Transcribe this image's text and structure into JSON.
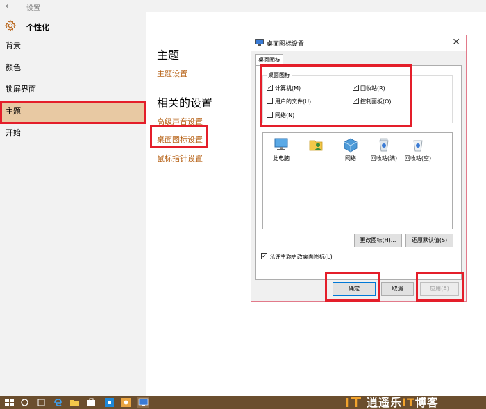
{
  "settings": {
    "title": "设置",
    "header": "个性化",
    "nav": [
      "背景",
      "颜色",
      "锁屏界面",
      "主题",
      "开始"
    ],
    "selected_index": 3
  },
  "content": {
    "theme_heading": "主题",
    "theme_settings_link": "主题设置",
    "related_heading": "相关的设置",
    "links": [
      "高级声音设置",
      "桌面图标设置",
      "鼠标指针设置"
    ]
  },
  "dialog": {
    "title": "桌面图标设置",
    "tab": "桌面图标",
    "group_label": "桌面图标",
    "checkboxes": [
      {
        "label": "计算机(M)",
        "checked": true
      },
      {
        "label": "回收站(R)",
        "checked": true
      },
      {
        "label": "用户的文件(U)",
        "checked": false
      },
      {
        "label": "控制面板(O)",
        "checked": true
      },
      {
        "label": "网络(N)",
        "checked": false
      }
    ],
    "icons": [
      {
        "label": "此电脑",
        "icon": "this-pc-icon"
      },
      {
        "label": "",
        "icon": "user-files-icon"
      },
      {
        "label": "网络",
        "icon": "network-icon"
      },
      {
        "label": "回收站(满)",
        "icon": "recycle-bin-full-icon"
      },
      {
        "label": "回收站(空)",
        "icon": "recycle-bin-empty-icon"
      }
    ],
    "change_icon_button": "更改图标(H)...",
    "restore_default_button": "还原默认值(S)",
    "allow_themes_checkbox": "允许主题更改桌面图标(L)",
    "allow_themes_checked": true,
    "ok_button": "确定",
    "cancel_button": "取消",
    "apply_button": "应用(A)"
  },
  "taskbar": {
    "brand_prefix": "逍遥乐",
    "brand_it": "IT",
    "brand_suffix": "博客",
    "brand_logo_letters": "IT"
  },
  "colors": {
    "accent_orange": "#b8651b",
    "selection": "#e8c9a3",
    "annotation_red": "#e41e2a",
    "taskbar": "#6b4e2e"
  }
}
